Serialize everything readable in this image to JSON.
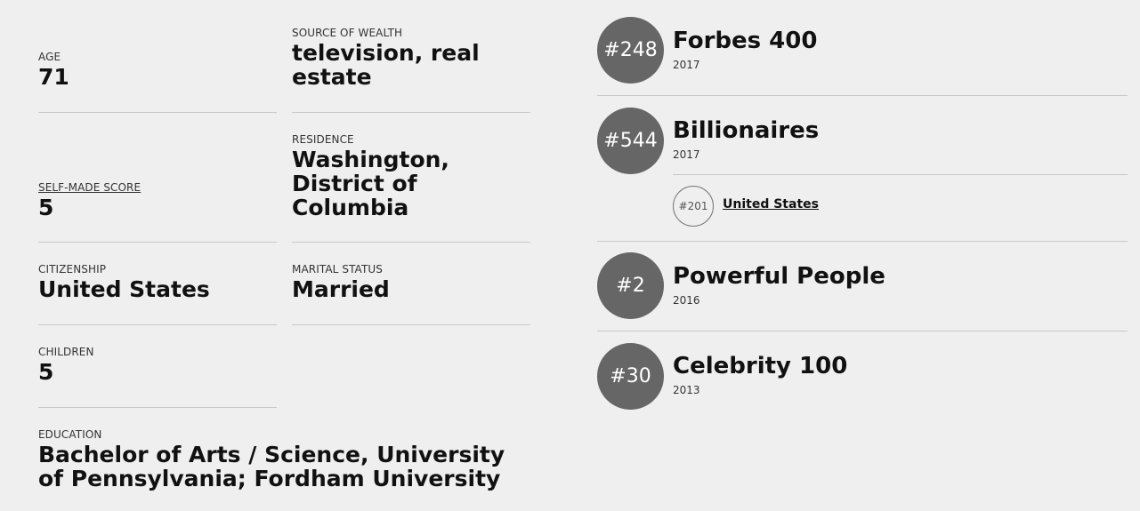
{
  "stats": {
    "age": {
      "label": "AGE",
      "value": "71"
    },
    "source_of_wealth": {
      "label": "SOURCE OF WEALTH",
      "value": "television, real estate"
    },
    "self_made_score": {
      "label": "SELF-MADE SCORE",
      "value": "5"
    },
    "residence": {
      "label": "RESIDENCE",
      "value": "Washington, District of Columbia"
    },
    "citizenship": {
      "label": "CITIZENSHIP",
      "value": "United States"
    },
    "marital_status": {
      "label": "MARITAL STATUS",
      "value": "Married"
    },
    "children": {
      "label": "CHILDREN",
      "value": "5"
    },
    "education": {
      "label": "EDUCATION",
      "value": "Bachelor of Arts / Science, University of Pennsylvania; Fordham University"
    }
  },
  "rankings": [
    {
      "rank": "#248",
      "title": "Forbes 400",
      "year": "2017"
    },
    {
      "rank": "#544",
      "title": "Billionaires",
      "year": "2017",
      "sub": {
        "rank": "#201",
        "label": "United States"
      }
    },
    {
      "rank": "#2",
      "title": "Powerful People",
      "year": "2016"
    },
    {
      "rank": "#30",
      "title": "Celebrity 100",
      "year": "2013"
    }
  ],
  "colors": {
    "background": "#efefef",
    "circle": "#666666",
    "rule": "#c8c8c8"
  }
}
